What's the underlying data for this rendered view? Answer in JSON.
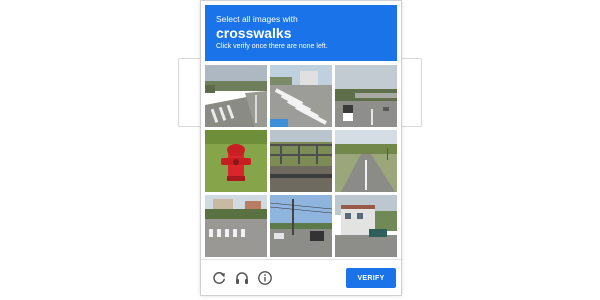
{
  "challenge": {
    "instruction_line1": "Select all images with",
    "target_word": "crosswalks",
    "instruction_line3": "Click verify once there are none left.",
    "header_color": "#1a73e8"
  },
  "tiles": [
    {
      "description": "street with pedestrian crossing marking"
    },
    {
      "description": "zebra crosswalk on road"
    },
    {
      "description": "highway overpass with cars"
    },
    {
      "description": "red fire hydrant on grass"
    },
    {
      "description": "metal fence by field"
    },
    {
      "description": "road through countryside"
    },
    {
      "description": "intersection with crosswalk"
    },
    {
      "description": "street with power lines"
    },
    {
      "description": "building by road"
    }
  ],
  "footer": {
    "icons": [
      "reload-icon",
      "headphones-icon",
      "info-icon"
    ],
    "verify_label": "VERIFY"
  }
}
